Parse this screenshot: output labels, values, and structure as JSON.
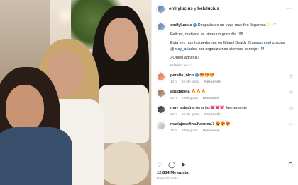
{
  "post": {
    "author": "emilylucius",
    "collab": "y",
    "coauthor": "belulucius",
    "caption": {
      "user": "emilylucius",
      "verified_mark": "✓",
      "line1": "Después de un viaje muy feo llegamos ✨ ♡",
      "line2": "Felices, mañana se viene un gran día !!!!!",
      "line3a": "Esta vez nos hospedamos en Miami Beach",
      "line3_link": "@upsunhotel",
      "line3b": "gracias",
      "line4_link": "@may_ariadna",
      "line4b": "por organizarnos siempre lo mejor !!!!",
      "line5": "¿Quien adivina?",
      "edited": "Editado · 14 h"
    },
    "comments": [
      {
        "user": "peralta_nico",
        "verified_mark": "✓",
        "text": "😍😍😍",
        "time": "14 h",
        "likes": "19 Me gusta",
        "reply": "Responder"
      },
      {
        "user": "abudadela",
        "text": "🔥🔥🔥",
        "time": "14 h",
        "likes": "2 Me gusta",
        "reply": "Responder"
      },
      {
        "user": "may_ariadna",
        "text": "Amarlas💗💗💗 fuertemente",
        "time": "14 h",
        "likes": "10 Me gusta",
        "reply": "Responder"
      },
      {
        "user": "mariajosefina.fuentes.7",
        "text": "😍😍😍",
        "time": "13 h",
        "likes": "3 Me gusta",
        "reply": "Responder"
      }
    ],
    "more_icon": "···",
    "heart_icon": "♡",
    "likes": "12.834 Me gusta",
    "posted": "Hace 14 horas"
  },
  "icons": {
    "like": "♡",
    "comment": "◯",
    "share": "➤",
    "save": "⊓"
  }
}
